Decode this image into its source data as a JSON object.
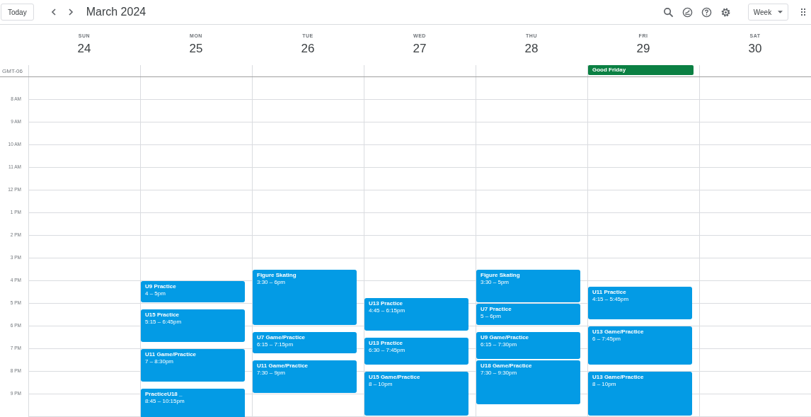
{
  "toolbar": {
    "today": "Today",
    "title": "March 2024",
    "view": "Week"
  },
  "timezone": "GMT-06",
  "hours": [
    "8 AM",
    "9 AM",
    "10 AM",
    "11 AM",
    "12 PM",
    "1 PM",
    "2 PM",
    "3 PM",
    "4 PM",
    "5 PM",
    "6 PM",
    "7 PM",
    "8 PM",
    "9 PM"
  ],
  "days": [
    {
      "name": "SUN",
      "number": "24"
    },
    {
      "name": "MON",
      "number": "25",
      "events": [
        {
          "title": "U9 Practice",
          "time": "4 – 5pm"
        },
        {
          "title": "U15 Practice",
          "time": "5:15 – 6:45pm"
        },
        {
          "title": "U11 Game/Practice",
          "time": "7 – 8:30pm"
        },
        {
          "title": "PracticeU18 _",
          "time": "8:45 – 10:15pm"
        }
      ]
    },
    {
      "name": "TUE",
      "number": "26",
      "events": [
        {
          "title": "Figure Skating",
          "time": "3:30 – 6pm"
        },
        {
          "title": "U7 Game/Practice",
          "time": "6:15 – 7:15pm"
        },
        {
          "title": "U11 Game/Practice",
          "time": "7:30 – 9pm"
        }
      ]
    },
    {
      "name": "WED",
      "number": "27",
      "events": [
        {
          "title": "U13 Practice",
          "time": "4:45 – 6:15pm"
        },
        {
          "title": "U13 Practice",
          "time": "6:30 – 7:45pm"
        },
        {
          "title": "U15 Game/Practice",
          "time": "8 – 10pm"
        }
      ]
    },
    {
      "name": "THU",
      "number": "28",
      "events": [
        {
          "title": "Figure Skating",
          "time": "3:30 – 5pm"
        },
        {
          "title": "U7 Practice",
          "time": "5 – 6pm"
        },
        {
          "title": "U9 Game/Practice",
          "time": "6:15 – 7:30pm"
        },
        {
          "title": "U18 Game/Practice",
          "time": "7:30 – 9:30pm"
        }
      ]
    },
    {
      "name": "FRI",
      "number": "29",
      "all_day": [
        {
          "title": "Good Friday",
          "color": "#0b8043"
        }
      ],
      "events": [
        {
          "title": "U11 Practice",
          "time": "4:15 – 5:45pm"
        },
        {
          "title": "U13 Game/Practice",
          "time": "6 – 7:45pm"
        },
        {
          "title": "U13 Game/Practice",
          "time": "8 – 10pm"
        }
      ]
    },
    {
      "name": "SAT",
      "number": "30"
    }
  ]
}
